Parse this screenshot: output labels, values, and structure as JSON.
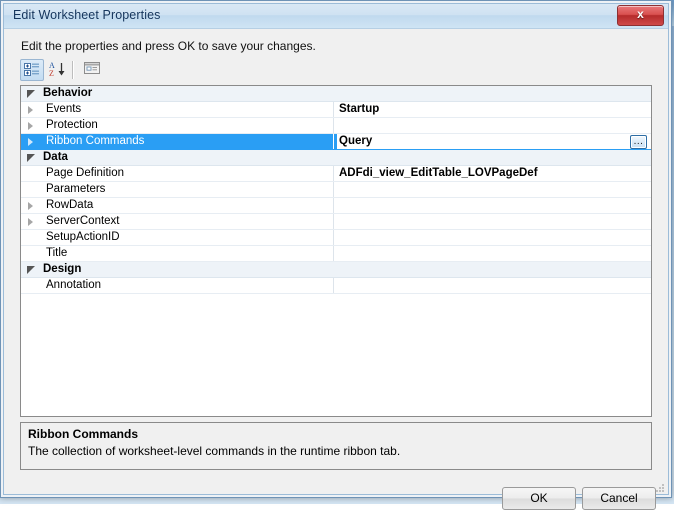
{
  "window": {
    "title": "Edit Worksheet Properties",
    "close_label": "x"
  },
  "instruction": "Edit the properties and press OK to save your changes.",
  "toolbar": {
    "categorized_label": "Categorized",
    "alphabetical_label": "Alphabetical",
    "property_pages_label": "Property Pages"
  },
  "grid": {
    "rows": [
      {
        "kind": "category",
        "state": "expanded",
        "name": "Behavior",
        "value": ""
      },
      {
        "kind": "property",
        "state": "collapsed",
        "name": "Events",
        "value": "Startup"
      },
      {
        "kind": "property",
        "state": "collapsed",
        "name": "Protection",
        "value": ""
      },
      {
        "kind": "property",
        "state": "collapsed",
        "name": "Ribbon Commands",
        "value": "Query",
        "selected": true,
        "ellipsis": "..."
      },
      {
        "kind": "category",
        "state": "expanded",
        "name": "Data",
        "value": ""
      },
      {
        "kind": "property",
        "state": "leaf",
        "name": "Page Definition",
        "value": "ADFdi_view_EditTable_LOVPageDef"
      },
      {
        "kind": "property",
        "state": "leaf",
        "name": "Parameters",
        "value": ""
      },
      {
        "kind": "property",
        "state": "collapsed",
        "name": "RowData",
        "value": ""
      },
      {
        "kind": "property",
        "state": "collapsed",
        "name": "ServerContext",
        "value": ""
      },
      {
        "kind": "property",
        "state": "leaf",
        "name": "SetupActionID",
        "value": ""
      },
      {
        "kind": "property",
        "state": "leaf",
        "name": "Title",
        "value": ""
      },
      {
        "kind": "category",
        "state": "expanded",
        "name": "Design",
        "value": ""
      },
      {
        "kind": "property",
        "state": "leaf",
        "name": "Annotation",
        "value": ""
      }
    ]
  },
  "description": {
    "title": "Ribbon Commands",
    "text": "The collection of worksheet-level commands in the runtime ribbon tab."
  },
  "footer": {
    "ok_label": "OK",
    "cancel_label": "Cancel"
  },
  "colors": {
    "selection": "#2a9ef4",
    "title_text": "#15355c",
    "close_button": "#b52b2b",
    "dialog_face": "#f0f0f0"
  }
}
